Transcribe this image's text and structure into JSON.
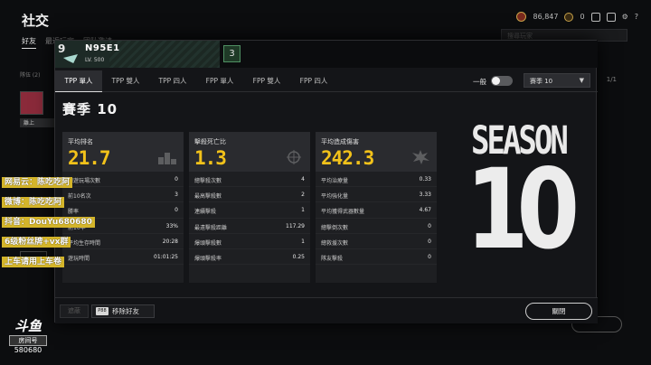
{
  "background": {
    "title": "社交",
    "tabs": [
      "好友",
      "最近玩家",
      "团队邀请"
    ],
    "bp_amount": "86,847",
    "g_coin": "0",
    "search_placeholder": "搜尋玩家",
    "page_indicator": "1/1",
    "left_status": "離上",
    "left_sub": "隊伍 (2)"
  },
  "watermark": {
    "lines": [
      "网易云：陈吃吃阿",
      "微博：陈吃吃阿",
      "抖音：DouYu680680",
      "6级粉丝牌+vx群",
      "上车请用上车卷"
    ],
    "logo_brand": "斗鱼",
    "logo_tag": "房间号",
    "logo_room": "580680"
  },
  "profile": {
    "name": "N95E1",
    "level": "LV. 500",
    "rank_badge": "3",
    "tabs": [
      {
        "label": "TPP 單人",
        "active": true
      },
      {
        "label": "TPP 雙人",
        "active": false
      },
      {
        "label": "TPP 四人",
        "active": false
      },
      {
        "label": "FPP 單人",
        "active": false
      },
      {
        "label": "FPP 雙人",
        "active": false
      },
      {
        "label": "FPP 四人",
        "active": false
      }
    ],
    "mode_label": "一般",
    "season_select": "賽季 10",
    "season_title": "賽季 10"
  },
  "cards": [
    {
      "label": "平均排名",
      "value": "21.7",
      "icon": "podium-icon",
      "rows": [
        {
          "k": "總遊玩場次數",
          "v": "0"
        },
        {
          "k": "前10名次",
          "v": "3"
        },
        {
          "k": "勝率",
          "v": "0"
        },
        {
          "k": "前10率",
          "v": "33%"
        },
        {
          "k": "平均生存時間",
          "v": "20:28"
        },
        {
          "k": "遊玩時間",
          "v": "01:01:25"
        }
      ]
    },
    {
      "label": "擊殺死亡比",
      "value": "1.3",
      "icon": "crosshair-icon",
      "rows": [
        {
          "k": "總擊殺次數",
          "v": "4"
        },
        {
          "k": "最高擊殺數",
          "v": "2"
        },
        {
          "k": "連續擊殺",
          "v": "1"
        },
        {
          "k": "最遠擊殺距離",
          "v": "117.29"
        },
        {
          "k": "爆頭擊殺數",
          "v": "1"
        },
        {
          "k": "爆頭擊殺率",
          "v": "0.25"
        }
      ]
    },
    {
      "label": "平均造成傷害",
      "value": "242.3",
      "icon": "explosion-icon",
      "rows": [
        {
          "k": "平均治療量",
          "v": "0.33"
        },
        {
          "k": "平均強化量",
          "v": "3.33"
        },
        {
          "k": "平均獲得武器數量",
          "v": "4.67"
        },
        {
          "k": "總擊倒次數",
          "v": "0"
        },
        {
          "k": "總救援次數",
          "v": "0"
        },
        {
          "k": "隊友擊殺",
          "v": "0"
        }
      ]
    }
  ],
  "season_art": {
    "word": "SEASON",
    "number": "10"
  },
  "footer": {
    "block_label": "遮蔽",
    "remove_key": "P88",
    "remove_label": "移除好友",
    "close_label": "關閉"
  }
}
